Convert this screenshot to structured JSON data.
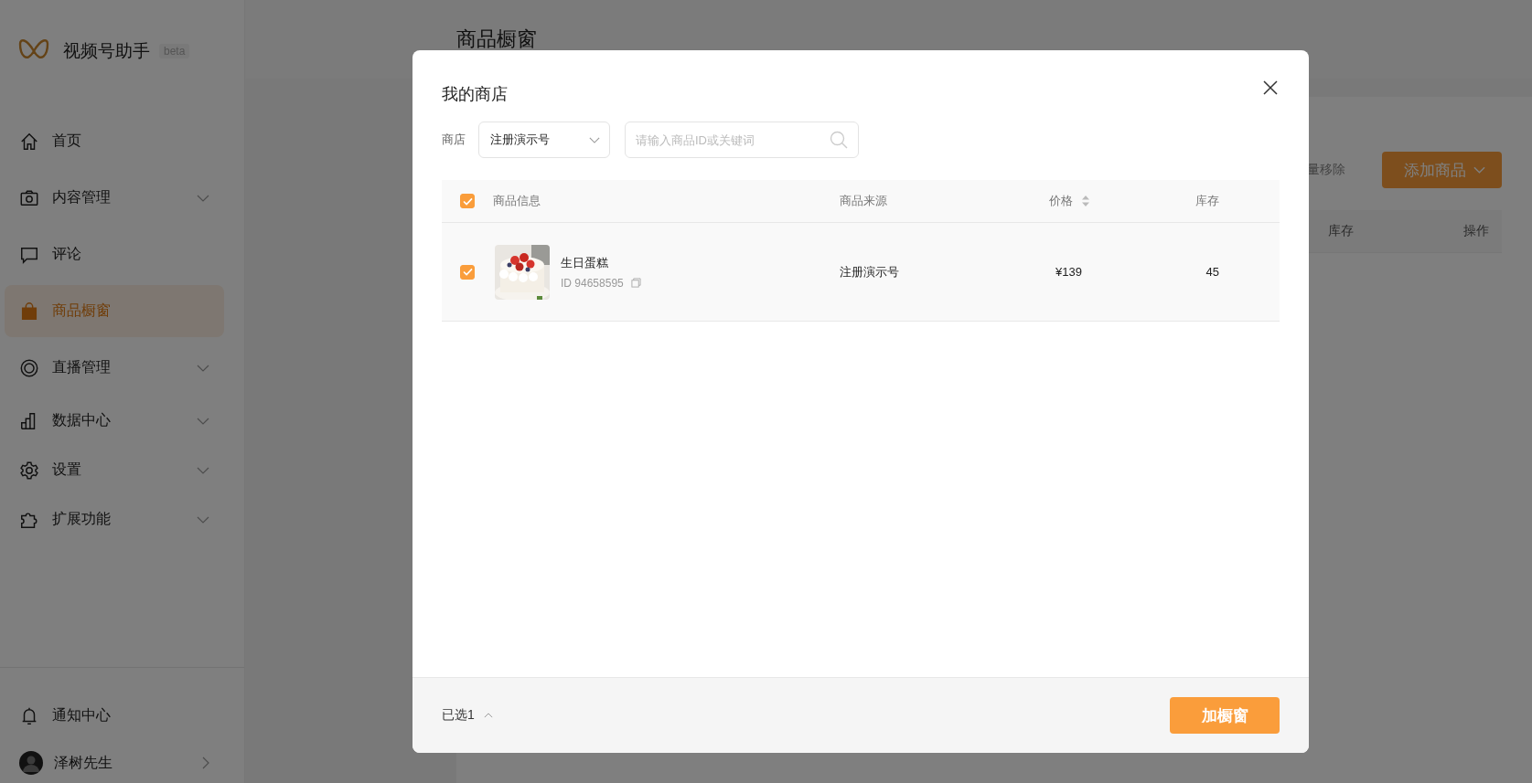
{
  "sidebar": {
    "app_name": "视频号助手",
    "badge": "beta",
    "items": [
      {
        "label": "首页",
        "expandable": false,
        "selected": false
      },
      {
        "label": "内容管理",
        "expandable": true,
        "selected": false
      },
      {
        "label": "评论",
        "expandable": false,
        "selected": false
      },
      {
        "label": "商品橱窗",
        "expandable": false,
        "selected": true
      },
      {
        "label": "直播管理",
        "expandable": true,
        "selected": false
      },
      {
        "label": "数据中心",
        "expandable": true,
        "selected": false
      },
      {
        "label": "设置",
        "expandable": true,
        "selected": false
      },
      {
        "label": "扩展功能",
        "expandable": true,
        "selected": false
      }
    ],
    "notifications": "通知中心",
    "user": "泽树先生"
  },
  "page": {
    "title": "商品橱窗",
    "batch_remove": "量移除",
    "add_button": "添加商品",
    "table_columns": [
      "库存",
      "操作"
    ]
  },
  "dialog": {
    "title": "我的商店",
    "store_label": "商店",
    "store_value": "注册演示号",
    "search": {
      "placeholder": "请输入商品ID或关键词"
    },
    "columns": [
      {
        "label": "商品信息",
        "sortable": false
      },
      {
        "label": "商品来源",
        "sortable": false
      },
      {
        "label": "价格",
        "sortable": true
      },
      {
        "label": "库存",
        "sortable": false
      }
    ],
    "all_checked": true,
    "rows": [
      {
        "checked": true,
        "name": "生日蛋糕",
        "id": "ID 94658595",
        "source": "注册演示号",
        "price": "¥139",
        "stock": "45"
      }
    ],
    "selected_count": "已选1",
    "confirm": "加橱窗"
  }
}
